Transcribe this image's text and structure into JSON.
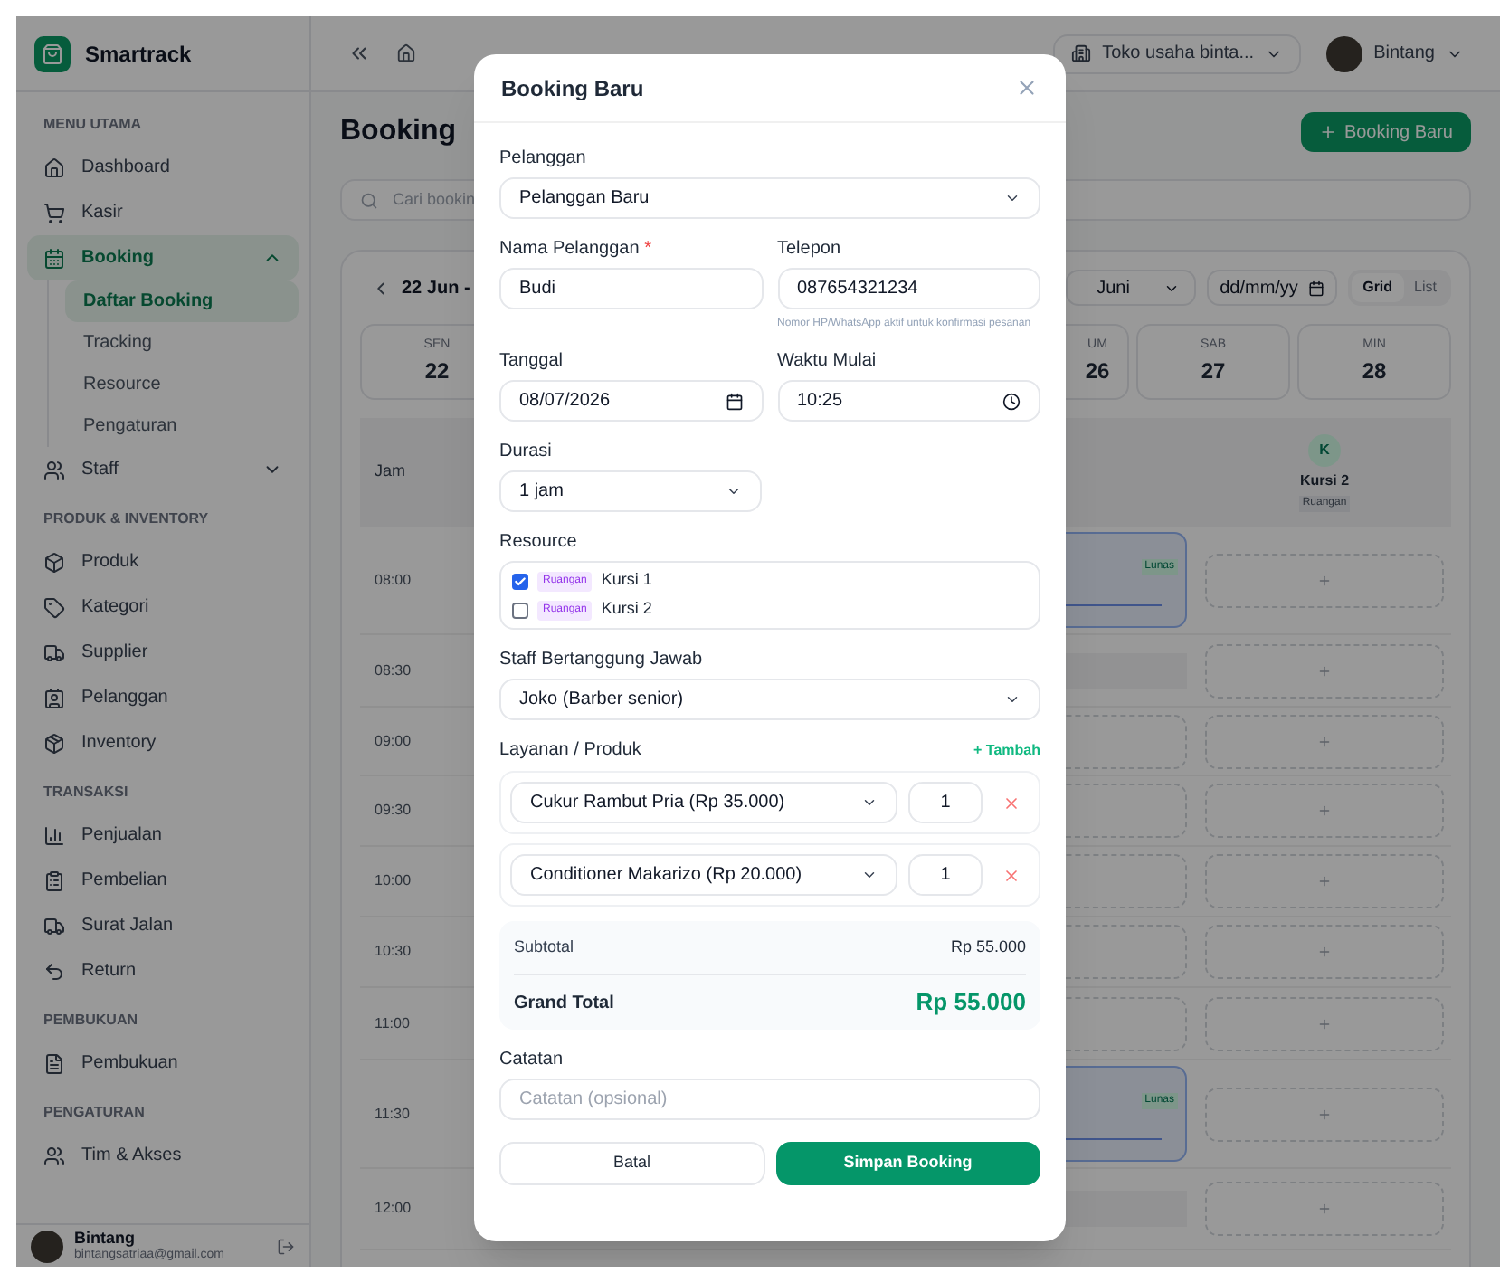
{
  "sidebar": {
    "brand": "Smartrack",
    "sections": [
      {
        "title": "MENU UTAMA",
        "items": [
          {
            "label": "Dashboard",
            "selected": false
          },
          {
            "label": "Kasir",
            "selected": false
          },
          {
            "label": "Booking",
            "selected": true,
            "expanded": true,
            "children": [
              {
                "label": "Daftar Booking",
                "selected": true
              },
              {
                "label": "Tracking",
                "selected": false
              },
              {
                "label": "Resource",
                "selected": false
              },
              {
                "label": "Pengaturan",
                "selected": false
              }
            ]
          },
          {
            "label": "Staff",
            "selected": false,
            "expanded": false
          }
        ]
      },
      {
        "title": "PRODUK & INVENTORY",
        "items": [
          {
            "label": "Produk",
            "selected": false
          },
          {
            "label": "Kategori",
            "selected": false
          },
          {
            "label": "Supplier",
            "selected": false
          },
          {
            "label": "Pelanggan",
            "selected": false
          },
          {
            "label": "Inventory",
            "selected": false
          }
        ]
      },
      {
        "title": "TRANSAKSI",
        "items": [
          {
            "label": "Penjualan",
            "selected": false
          },
          {
            "label": "Pembelian",
            "selected": false
          },
          {
            "label": "Surat Jalan",
            "selected": false
          },
          {
            "label": "Return",
            "selected": false
          }
        ]
      },
      {
        "title": "PEMBUKUAN",
        "items": [
          {
            "label": "Pembukuan",
            "selected": false
          }
        ]
      },
      {
        "title": "PENGATURAN",
        "items": [
          {
            "label": "Tim & Akses",
            "selected": false
          }
        ]
      }
    ],
    "user": {
      "name": "Bintang",
      "email": "bintangsatriaa@gmail.com"
    }
  },
  "topbar": {
    "store": "Toko usaha binta...",
    "user": "Bintang"
  },
  "page": {
    "title": "Booking",
    "new_button": "Booking Baru",
    "search": {
      "placeholder": "Cari bookin"
    }
  },
  "calendar": {
    "range": "22 Jun -",
    "month": "Juni",
    "date_field": {
      "placeholder": "dd/mm/yy"
    },
    "view_toggle": [
      {
        "label": "Grid",
        "selected": true
      },
      {
        "label": "List",
        "selected": false
      }
    ],
    "days": [
      {
        "weekday": "SEN",
        "day": "22"
      },
      {
        "weekday": "UM",
        "day": "26"
      },
      {
        "weekday": "SAB",
        "day": "27"
      },
      {
        "weekday": "MIN",
        "day": "28"
      }
    ],
    "time_header": "Jam",
    "resource": {
      "initial": "K",
      "name": "Kursi 2",
      "type": "Ruangan"
    },
    "rows": [
      {
        "time": "08:00",
        "kind": "booked",
        "status": "Lunas"
      },
      {
        "time": "08:30",
        "kind": "continued"
      },
      {
        "time": "09:00",
        "kind": "empty"
      },
      {
        "time": "09:30",
        "kind": "empty"
      },
      {
        "time": "10:00",
        "kind": "empty"
      },
      {
        "time": "10:30",
        "kind": "empty"
      },
      {
        "time": "11:00",
        "kind": "empty"
      },
      {
        "time": "11:30",
        "kind": "booked",
        "status": "Lunas"
      },
      {
        "time": "12:00",
        "kind": "continued"
      }
    ]
  },
  "modal": {
    "title": "Booking Baru",
    "customer_select": {
      "label": "Pelanggan",
      "value": "Pelanggan Baru"
    },
    "name_field": {
      "label": "Nama Pelanggan",
      "required_mark": "*",
      "value": "Budi"
    },
    "phone_field": {
      "label": "Telepon",
      "value": "087654321234",
      "hint": "Nomor HP/WhatsApp aktif untuk konfirmasi pesanan"
    },
    "date_field": {
      "label": "Tanggal",
      "value": "08/07/2026"
    },
    "time_field": {
      "label": "Waktu Mulai",
      "value": "10:25"
    },
    "duration_select": {
      "label": "Durasi",
      "value": "1 jam"
    },
    "resources": {
      "label": "Resource",
      "items": [
        {
          "tag": "Ruangan",
          "name": "Kursi 1",
          "checked": true
        },
        {
          "tag": "Ruangan",
          "name": "Kursi 2",
          "checked": false
        }
      ]
    },
    "staff_select": {
      "label": "Staff Bertanggung Jawab",
      "value": "Joko (Barber senior)"
    },
    "services": {
      "label": "Layanan / Produk",
      "add_link": "+ Tambah",
      "items": [
        {
          "product": "Cukur Rambut Pria (Rp 35.000)",
          "qty": "1"
        },
        {
          "product": "Conditioner Makarizo (Rp 20.000)",
          "qty": "1"
        }
      ]
    },
    "totals": {
      "subtotal_label": "Subtotal",
      "subtotal": "Rp 55.000",
      "grand_total_label": "Grand Total",
      "grand_total": "Rp 55.000"
    },
    "notes": {
      "label": "Catatan",
      "placeholder": "Catatan (opsional)"
    },
    "buttons": [
      {
        "label": "Batal",
        "kind": "secondary"
      },
      {
        "label": "Simpan Booking",
        "kind": "primary"
      }
    ]
  }
}
